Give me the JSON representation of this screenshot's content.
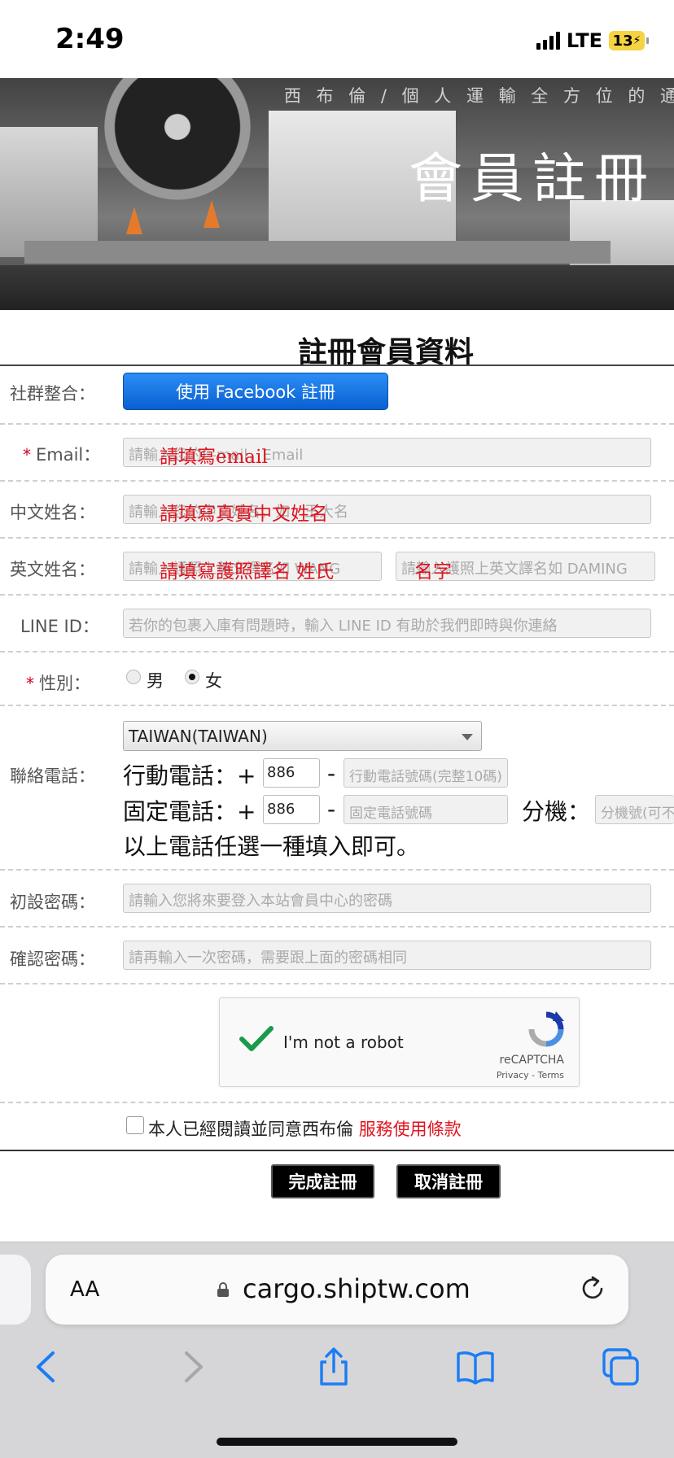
{
  "status_bar": {
    "time": "2:49",
    "network": "LTE",
    "battery": "13"
  },
  "banner": {
    "breadcrumb": "西 布 倫  /  個 人 運 輸 全 方 位 的 通",
    "title": "會員註冊"
  },
  "form": {
    "title": "註冊會員資料",
    "social": {
      "label": "社群整合：",
      "facebook_button": "使用 Facebook 註冊"
    },
    "email": {
      "required_mark": "*",
      "label": "Email：",
      "placeholder": "請輸入您的E-mail，Email",
      "overlay": "請填寫email"
    },
    "chinese_name": {
      "label": "中文姓名：",
      "placeholder": "請輸入您的中文姓名，如：王大名",
      "overlay": "請填寫真實中文姓名"
    },
    "english_name": {
      "label": "英文姓名：",
      "surname_placeholder": "請輸入護照上英文譯名如 WANG",
      "given_placeholder": "請輸入護照上英文譯名如 DAMING",
      "overlay_surname": "請填寫護照譯名  姓氏",
      "overlay_given": "名字"
    },
    "line_id": {
      "label": "LINE ID：",
      "placeholder": "若你的包裹入庫有問題時，輸入 LINE ID 有助於我們即時與你連絡"
    },
    "gender": {
      "required_mark": "*",
      "label": "性別：",
      "options": [
        "男",
        "女"
      ],
      "selected": "女"
    },
    "phone": {
      "label": "聯絡電話：",
      "country_select": "TAIWAN(TAIWAN)",
      "mobile_label": "行動電話：+",
      "mobile_code": "886",
      "mobile_placeholder": "行動電話號碼(完整10碼)",
      "landline_label": "固定電話：+",
      "landline_code": "886",
      "landline_placeholder": "固定電話號碼",
      "extension_label": "分機：",
      "extension_placeholder": "分機號(可不填)",
      "dash": "-",
      "note": "以上電話任選一種填入即可。"
    },
    "password": {
      "label": "初設密碼：",
      "placeholder": "請輸入您將來要登入本站會員中心的密碼"
    },
    "confirm_password": {
      "label": "確認密碼：",
      "placeholder": "請再輸入一次密碼，需要跟上面的密碼相同"
    },
    "recaptcha": {
      "label": "I'm not a robot",
      "brand": "reCAPTCHA",
      "links": "Privacy - Terms"
    },
    "agreement": {
      "text": "本人已經閱讀並同意西布倫 ",
      "link": "服務使用條款"
    },
    "submit_button": "完成註冊",
    "cancel_button": "取消註冊"
  },
  "safari": {
    "text_size_label": "AA",
    "url": "cargo.shiptw.com"
  },
  "colors": {
    "facebook_blue": "#1877f2",
    "alert_red": "#e0141e",
    "ios_blue": "#1a7cf5"
  }
}
